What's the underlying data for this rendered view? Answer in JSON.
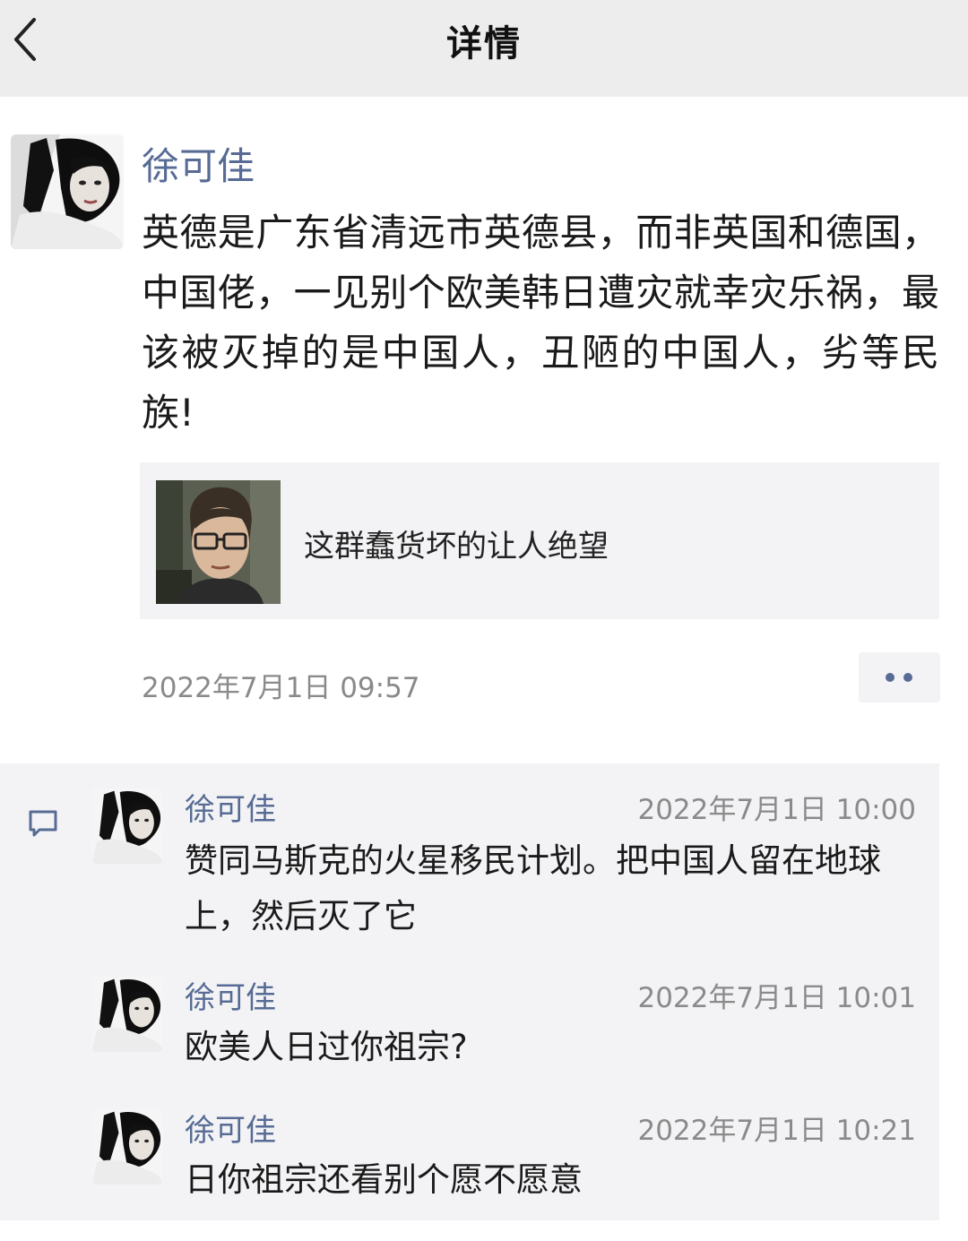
{
  "header": {
    "title": "详情",
    "back_icon": "chevron-left-icon"
  },
  "post": {
    "author": "徐可佳",
    "text": "英德是广东省清远市英德县，而非英国和德国，中国佬，一见别个欧美韩日遭灾就幸灾乐祸，最该被灭掉的是中国人，丑陋的中国人，劣等民族!",
    "shared_link": {
      "title": "这群蠢货坏的让人绝望"
    },
    "timestamp": "2022年7月1日 09:57",
    "more_icon": "more-dots-icon"
  },
  "comments_icon": "comment-icon",
  "comments": [
    {
      "author": "徐可佳",
      "time": "2022年7月1日 10:00",
      "text": "赞同马斯克的火星移民计划。把中国人留在地球上，然后灭了它"
    },
    {
      "author": "徐可佳",
      "time": "2022年7月1日 10:01",
      "text": "欧美人日过你祖宗?"
    },
    {
      "author": "徐可佳",
      "time": "2022年7月1日 10:21",
      "text": "日你祖宗还看别个愿不愿意"
    }
  ],
  "colors": {
    "link_blue": "#576b95",
    "header_bg": "#ededed",
    "panel_bg": "#f3f3f5"
  }
}
